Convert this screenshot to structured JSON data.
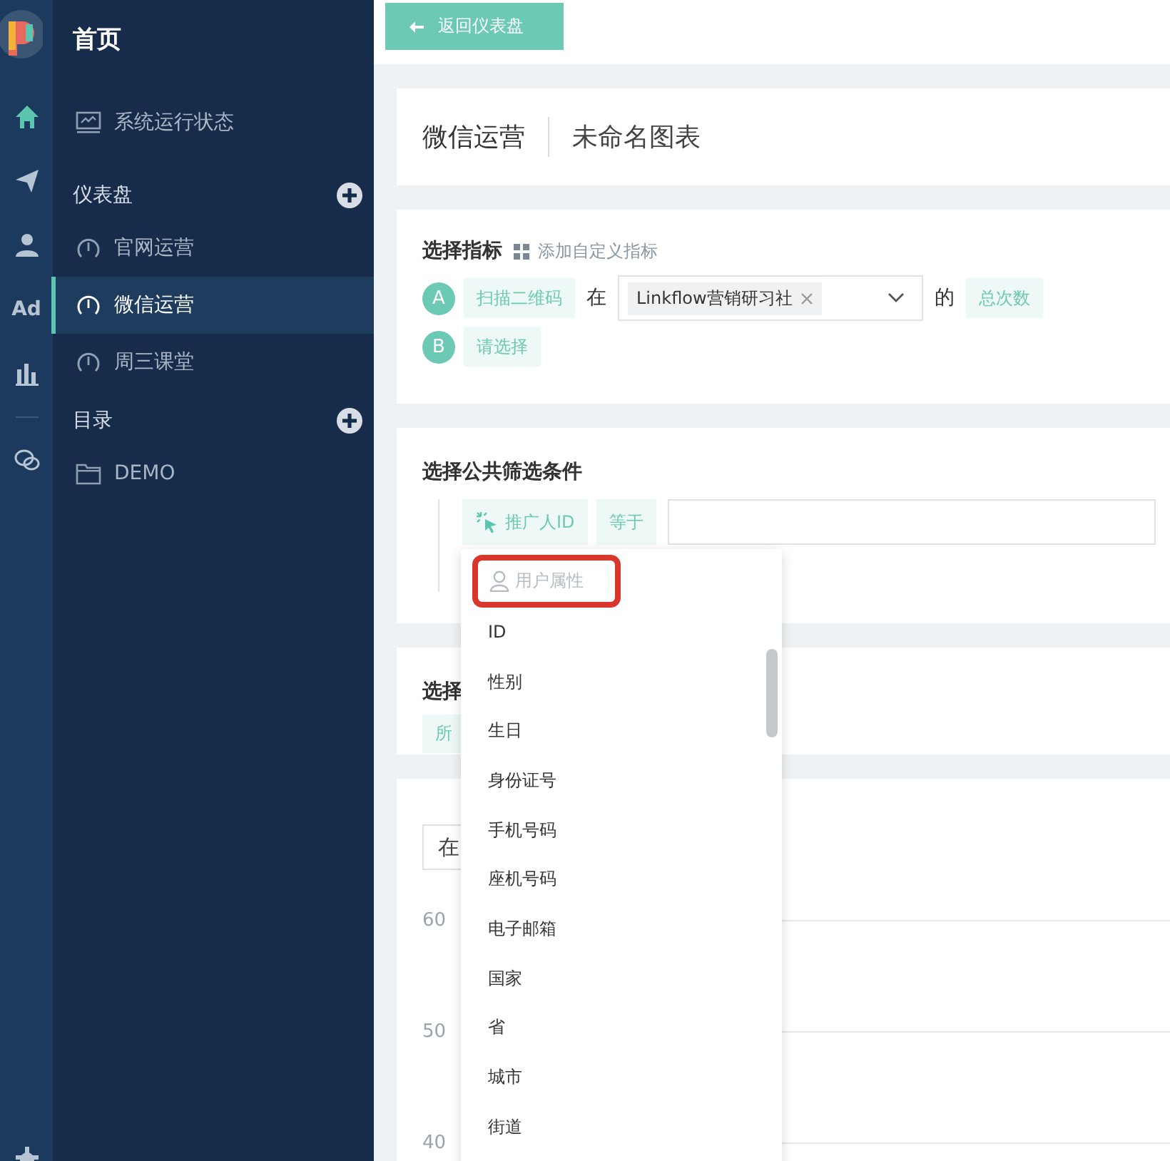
{
  "rail": {
    "items": [
      {
        "kind": "home",
        "selected": true
      },
      {
        "kind": "send",
        "selected": false
      },
      {
        "kind": "user",
        "selected": false
      },
      {
        "kind": "ad",
        "label": "Ad",
        "selected": false
      },
      {
        "kind": "chart",
        "selected": false
      },
      {
        "kind": "divider"
      },
      {
        "kind": "chat",
        "selected": false
      }
    ]
  },
  "sidebar": {
    "home": "首页",
    "status_item": "系统运行状态",
    "sections": [
      {
        "title": "仪表盘",
        "items": [
          {
            "label": "官网运营",
            "kind": "dashboard",
            "selected": false
          },
          {
            "label": "微信运营",
            "kind": "dashboard",
            "selected": true
          },
          {
            "label": "周三课堂",
            "kind": "dashboard",
            "selected": false
          }
        ]
      },
      {
        "title": "目录",
        "items": [
          {
            "label": "DEMO",
            "kind": "folder",
            "selected": false
          }
        ]
      }
    ]
  },
  "back_button": "返回仪表盘",
  "header": {
    "group": "微信运营",
    "chart_name": "未命名图表"
  },
  "metrics": {
    "title": "选择指标",
    "add_custom": "添加自定义指标",
    "rows": [
      {
        "letter": "A",
        "event": "扫描二维码",
        "in_label": "在",
        "chip": "Linkflow营销研习社",
        "of_label": "的",
        "measure": "总次数"
      },
      {
        "letter": "B",
        "event": "请选择"
      }
    ]
  },
  "filters": {
    "title": "选择公共筛选条件",
    "property": "推广人ID",
    "operator": "等于"
  },
  "section_4": {
    "title": "选择",
    "tag": "所"
  },
  "chart_card": {
    "select": "在",
    "y_labels": [
      "60",
      "50",
      "40"
    ]
  },
  "dropdown": {
    "header": {
      "label": "用户属性",
      "highlighted": true
    },
    "options": [
      "ID",
      "性别",
      "生日",
      "身份证号",
      "手机号码",
      "座机号码",
      "电子邮箱",
      "国家",
      "省",
      "城市",
      "街道"
    ]
  }
}
